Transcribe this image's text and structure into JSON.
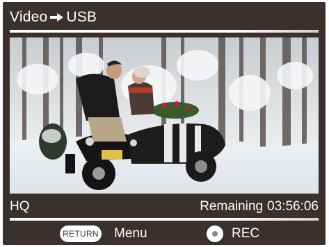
{
  "header": {
    "source": "Video",
    "arrow_icon": "arrow-right-icon",
    "destination": "USB"
  },
  "preview": {
    "description_icon": "video-frame"
  },
  "status": {
    "quality": "HQ",
    "remaining_label": "Remaining",
    "remaining_time": "03:56:06"
  },
  "footer": {
    "return_key": "RETURN",
    "menu_label": "Menu",
    "rec_key_icon": "record-dot-icon",
    "rec_label": "REC"
  },
  "colors": {
    "background": "#3a302c",
    "text": "#ffffff",
    "separator": "#ffffff"
  }
}
